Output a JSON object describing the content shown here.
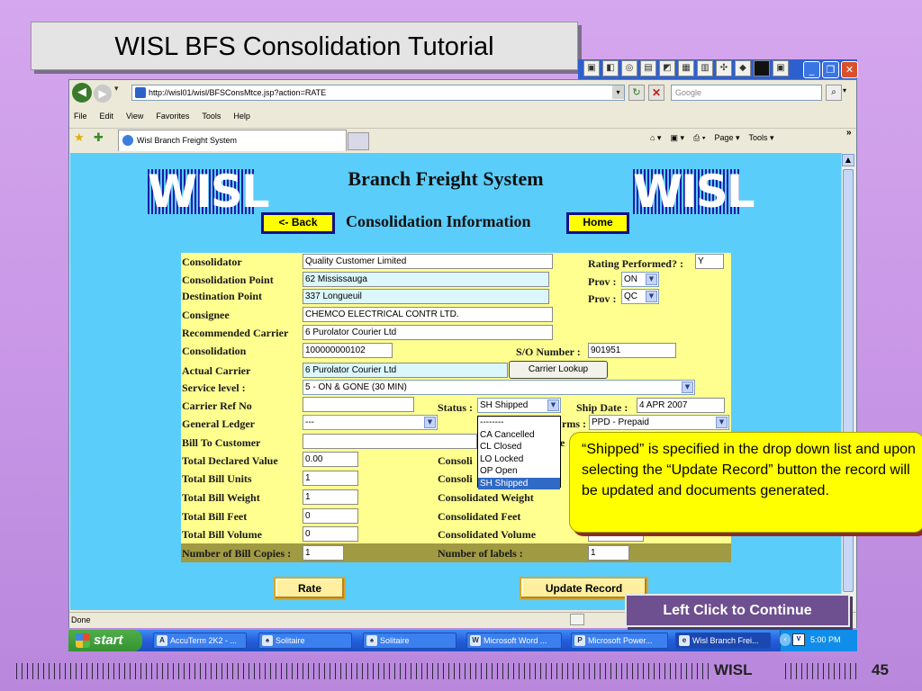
{
  "slide": {
    "title": "WISL BFS Consolidation Tutorial",
    "callout": "“Shipped” is specified in the drop down list and upon selecting the “Update Record” button the record will be updated and documents generated.",
    "continue_label": "Left Click to Continue",
    "footer_text": "WISL",
    "page_number": "45"
  },
  "browser": {
    "url": "http://wisl01/wisl/BFSConsMtce.jsp?action=RATE",
    "search_placeholder": "Google",
    "menu": [
      "File",
      "Edit",
      "View",
      "Favorites",
      "Tools",
      "Help"
    ],
    "tab_title": "Wisl Branch Freight System",
    "commands": {
      "page": "Page ▾",
      "tools": "Tools ▾"
    },
    "status_text": "Done"
  },
  "page": {
    "logo_text": "WISL",
    "title": "Branch Freight System",
    "subtitle": "Consolidation Information",
    "back_label": "<- Back",
    "home_label": "Home"
  },
  "form": {
    "labels": {
      "consolidator": "Consolidator",
      "consolidation_point": "Consolidation Point",
      "destination_point": "Destination Point",
      "consignee": "Consignee",
      "recommended_carrier": "Recommended Carrier",
      "consolidation": "Consolidation",
      "actual_carrier": "Actual Carrier",
      "service_level": "Service level :",
      "carrier_ref_no": "Carrier Ref No",
      "general_ledger": "General Ledger",
      "bill_to_customer": "Bill To Customer",
      "total_declared_value": "Total Declared Value",
      "total_bill_units": "Total Bill Units",
      "total_bill_weight": "Total Bill Weight",
      "total_bill_feet": "Total Bill Feet",
      "total_bill_volume": "Total Bill Volume",
      "number_of_bill_copies": "Number of Bill Copies :",
      "rating_performed": "Rating Performed? :",
      "prov1": "Prov :",
      "prov2": "Prov :",
      "so_number": "S/O Number :",
      "status": "Status :",
      "ship_date": "Ship Date :",
      "terms": "rms :",
      "consolidated_value": "Consoli",
      "consolidated_units": "Consoli",
      "consolidated_weight": "Consolidated Weight",
      "consolidated_feet": "Consolidated Feet",
      "consolidated_volume": "Consolidated Volume",
      "number_of_labels": "Number of labels :"
    },
    "values": {
      "consolidator": "Quality Customer Limited",
      "consolidation_point": "62 Mississauga",
      "destination_point": "337 Longueuil",
      "consignee": "CHEMCO ELECTRICAL CONTR LTD.",
      "recommended_carrier": "6 Purolator Courier Ltd",
      "consolidation": "100000000102",
      "actual_carrier": "6 Purolator Courier Ltd",
      "service_level": "5 - ON & GONE (30 MIN)",
      "carrier_ref_no": "",
      "general_ledger": "---",
      "bill_to_customer": "",
      "total_declared_value": "0.00",
      "total_bill_units": "1",
      "total_bill_weight": "1",
      "total_bill_feet": "0",
      "total_bill_volume": "0",
      "number_of_bill_copies": "1",
      "rating_performed": "Y",
      "prov1": "ON",
      "prov2": "QC",
      "so_number": "901951",
      "status": "SH Shipped",
      "ship_date": "4 APR 2007",
      "terms": "PPD - Prepaid",
      "bill_to_partial": "e",
      "consolidated_volume_partial": "0",
      "number_of_labels": "1"
    },
    "status_options": [
      "--------",
      "CA Cancelled",
      "CL Closed",
      "LO Locked",
      "OP Open",
      "SH Shipped"
    ],
    "carrier_lookup_label": "Carrier Lookup",
    "rate_label": "Rate",
    "update_record_label": "Update Record"
  },
  "taskbar": {
    "start_label": "start",
    "tasks": [
      "AccuTerm 2K2 - ...",
      "Solitaire",
      "Solitaire",
      "Microsoft Word ...",
      "Microsoft Power...",
      "Wisl Branch Frei..."
    ],
    "clock": "5:00 PM"
  },
  "colors": {
    "page_bg": "#5bcdfa",
    "form_bg": "#ffff8f",
    "callout_bg": "#ffff00",
    "continue_bg": "#6e4f8f",
    "slide_bg": "#d5a7ee"
  }
}
